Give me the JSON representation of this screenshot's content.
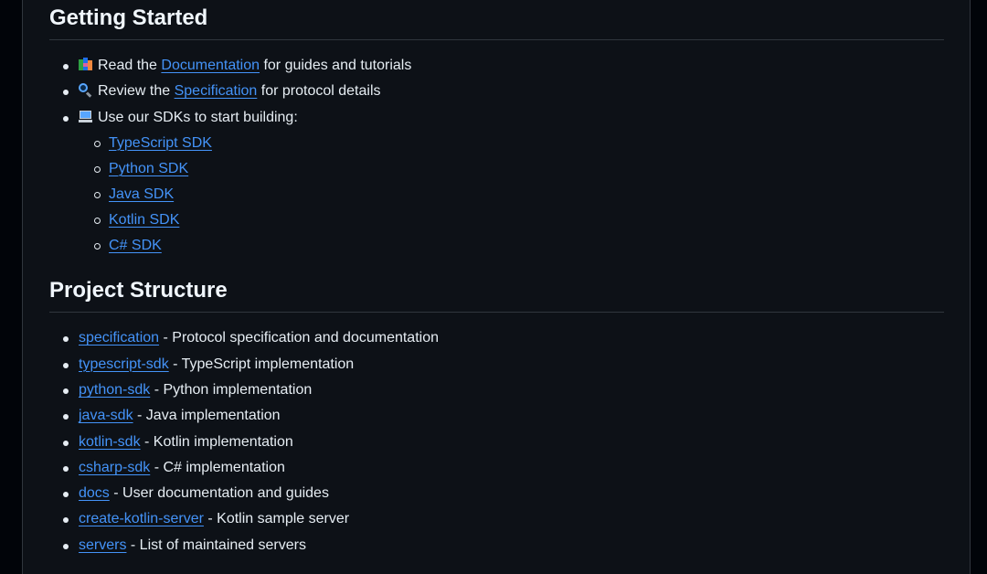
{
  "getting_started": {
    "heading": "Getting Started",
    "items": [
      {
        "icon": "books-icon",
        "prefix": "Read the ",
        "link": "Documentation",
        "suffix": " for guides and tutorials"
      },
      {
        "icon": "magnifier-icon",
        "prefix": "Review the ",
        "link": "Specification",
        "suffix": " for protocol details"
      },
      {
        "icon": "laptop-icon",
        "text": "Use our SDKs to start building:"
      }
    ],
    "sdks": [
      "TypeScript SDK",
      "Python SDK",
      "Java SDK",
      "Kotlin SDK",
      "C# SDK"
    ]
  },
  "project_structure": {
    "heading": "Project Structure",
    "items": [
      {
        "link": "specification",
        "desc": " - Protocol specification and documentation"
      },
      {
        "link": "typescript-sdk",
        "desc": " - TypeScript implementation"
      },
      {
        "link": "python-sdk",
        "desc": " - Python implementation"
      },
      {
        "link": "java-sdk",
        "desc": " - Java implementation"
      },
      {
        "link": "kotlin-sdk",
        "desc": " - Kotlin implementation"
      },
      {
        "link": "csharp-sdk",
        "desc": " - C# implementation"
      },
      {
        "link": "docs",
        "desc": " - User documentation and guides"
      },
      {
        "link": "create-kotlin-server",
        "desc": " - Kotlin sample server"
      },
      {
        "link": "servers",
        "desc": " - List of maintained servers"
      }
    ]
  },
  "colors": {
    "background": "#0d1117",
    "link": "#4493f8",
    "text": "#e6edf3",
    "border": "#30363d"
  }
}
